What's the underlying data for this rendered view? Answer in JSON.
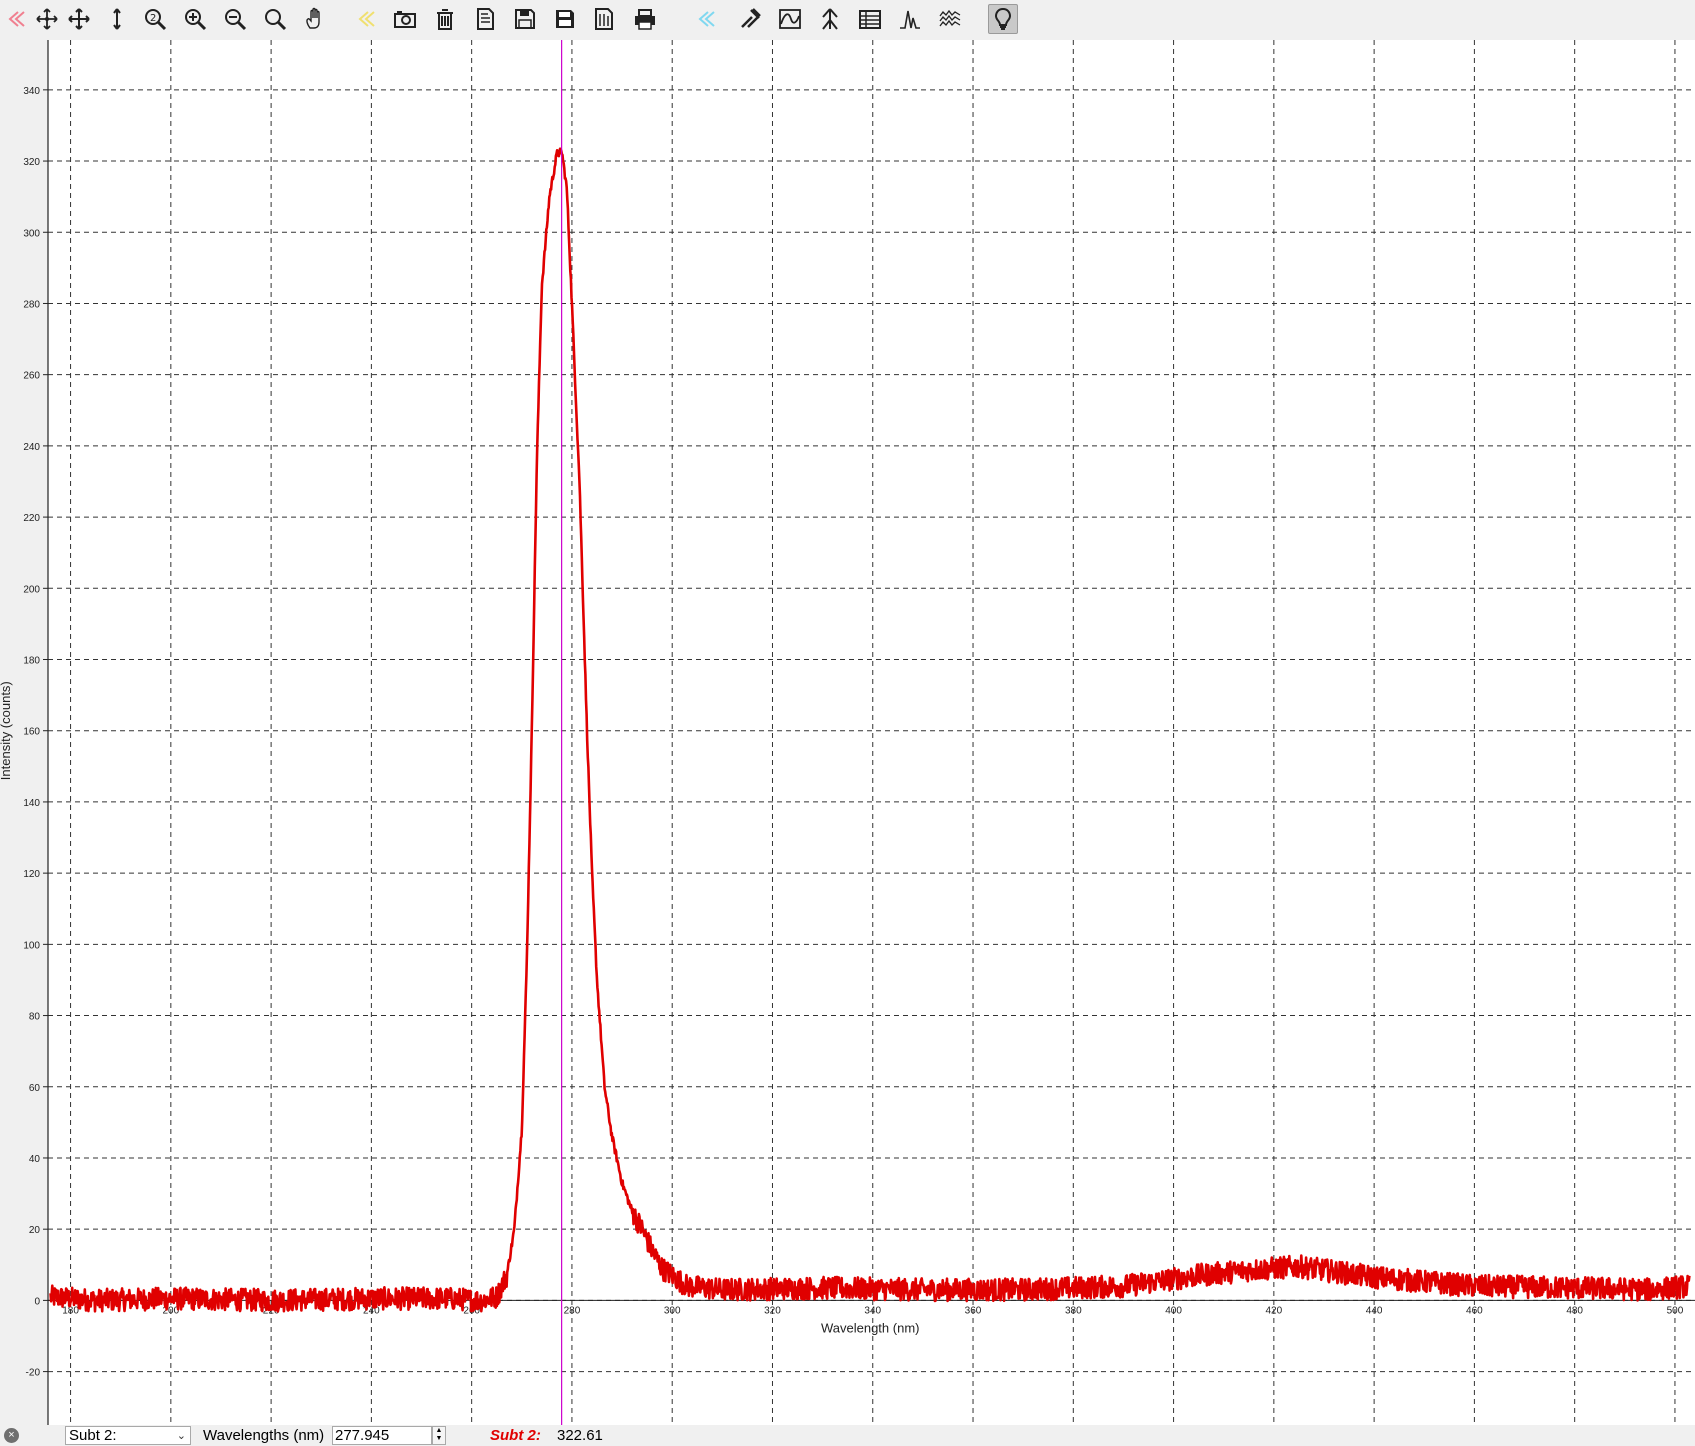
{
  "toolbar": {
    "buttons": [
      {
        "name": "back-icon"
      },
      {
        "name": "move-cursor-icon"
      },
      {
        "name": "crosshair-icon"
      },
      {
        "name": "vertical-cursor-icon"
      },
      {
        "name": "auto-scale-icon"
      },
      {
        "name": "zoom-in-icon"
      },
      {
        "name": "zoom-out-icon"
      },
      {
        "name": "zoom-icon"
      },
      {
        "name": "pan-hand-icon"
      },
      {
        "name": "back-yellow-icon"
      },
      {
        "name": "camera-icon"
      },
      {
        "name": "trash-icon"
      },
      {
        "name": "open-file-icon"
      },
      {
        "name": "save-icon"
      },
      {
        "name": "save-as-icon"
      },
      {
        "name": "export-icon"
      },
      {
        "name": "print-icon"
      },
      {
        "name": "back-blue-icon"
      },
      {
        "name": "tools-icon"
      },
      {
        "name": "baseline-icon"
      },
      {
        "name": "peak-pick-icon"
      },
      {
        "name": "table-icon"
      },
      {
        "name": "peaks-icon"
      },
      {
        "name": "spectrum-stack-icon"
      },
      {
        "name": "lightbulb-icon"
      }
    ]
  },
  "chart_data": {
    "type": "line",
    "xlabel": "Wavelength (nm)",
    "ylabel": "Intensity (counts)",
    "xlim": [
      175.5,
      504
    ],
    "ylim": [
      -35,
      354
    ],
    "x_ticks": [
      "180",
      "200",
      "220",
      "240",
      "260",
      "280",
      "300",
      "320",
      "340",
      "360",
      "380",
      "400",
      "420",
      "440",
      "460",
      "480",
      "500"
    ],
    "y_ticks": [
      "-20",
      "0",
      "20",
      "40",
      "60",
      "80",
      "100",
      "120",
      "140",
      "160",
      "180",
      "200",
      "220",
      "240",
      "260",
      "280",
      "300",
      "320",
      "340"
    ],
    "grid": true,
    "cursor_x": 277.945,
    "series": [
      {
        "name": "Subt 2:",
        "color": "#e00000",
        "points": [
          [
            176,
            1
          ],
          [
            185,
            0
          ],
          [
            200,
            0.5
          ],
          [
            220,
            0
          ],
          [
            240,
            0.5
          ],
          [
            255,
            0.5
          ],
          [
            262,
            0
          ],
          [
            265,
            1
          ],
          [
            267,
            7
          ],
          [
            268.5,
            20
          ],
          [
            270,
            48
          ],
          [
            271,
            95
          ],
          [
            272,
            160
          ],
          [
            273,
            235
          ],
          [
            274,
            285
          ],
          [
            275.5,
            310
          ],
          [
            277,
            322
          ],
          [
            278,
            322.6
          ],
          [
            279,
            312
          ],
          [
            280,
            280
          ],
          [
            281.5,
            230
          ],
          [
            283,
            160
          ],
          [
            284,
            120
          ],
          [
            285,
            90
          ],
          [
            286.5,
            60
          ],
          [
            288,
            46
          ],
          [
            290,
            33
          ],
          [
            292,
            25
          ],
          [
            294,
            20
          ],
          [
            296,
            14
          ],
          [
            298,
            9
          ],
          [
            300,
            7
          ],
          [
            303,
            4
          ],
          [
            310,
            3
          ],
          [
            330,
            3.5
          ],
          [
            350,
            3
          ],
          [
            370,
            3
          ],
          [
            390,
            4
          ],
          [
            405,
            7
          ],
          [
            415,
            8.5
          ],
          [
            425,
            9.5
          ],
          [
            440,
            6.5
          ],
          [
            460,
            4
          ],
          [
            480,
            3.5
          ],
          [
            495,
            3
          ],
          [
            503,
            4
          ]
        ]
      }
    ]
  },
  "status": {
    "close_icon": "×",
    "series_select": "Subt 2:",
    "wavelength_label": "Wavelengths (nm)",
    "wavelength_value": "277.945",
    "spin_up": "▲",
    "spin_down": "▼",
    "readout_name": "Subt  2:",
    "readout_value": "322.61"
  }
}
